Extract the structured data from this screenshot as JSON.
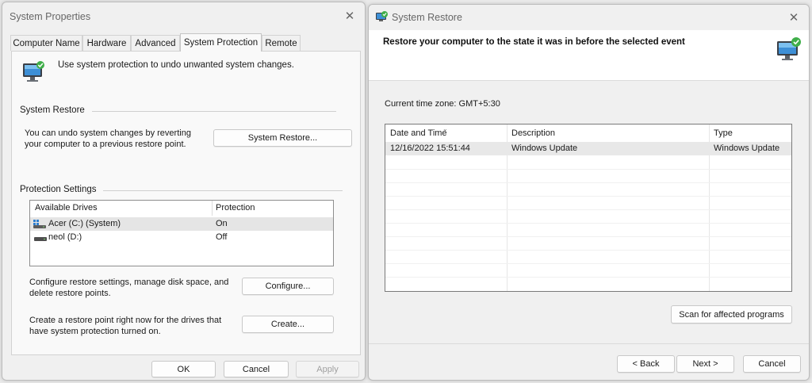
{
  "system_properties": {
    "title": "System Properties",
    "tabs": [
      "Computer Name",
      "Hardware",
      "Advanced",
      "System Protection",
      "Remote"
    ],
    "active_tab": "System Protection",
    "intro_text": "Use system protection to undo unwanted system changes.",
    "system_restore_group": {
      "label": "System Restore",
      "text_line1": "You can undo system changes by reverting",
      "text_line2": "your computer to a previous restore point.",
      "button": "System Restore..."
    },
    "protection_settings_group": {
      "label": "Protection Settings",
      "columns": [
        "Available Drives",
        "Protection"
      ],
      "drives": [
        {
          "name": "Acer (C:) (System)",
          "protection": "On",
          "icon": "system-drive-icon"
        },
        {
          "name": "neol (D:)",
          "protection": "Off",
          "icon": "drive-icon"
        }
      ],
      "configure_text_line1": "Configure restore settings, manage disk space, and",
      "configure_text_line2": "delete restore points.",
      "configure_button": "Configure...",
      "create_text_line1": "Create a restore point right now for the drives that",
      "create_text_line2": "have system protection turned on.",
      "create_button": "Create..."
    },
    "buttons": {
      "ok": "OK",
      "cancel": "Cancel",
      "apply": "Apply"
    }
  },
  "system_restore": {
    "title": "System Restore",
    "heading": "Restore your computer to the state it was in before the selected event",
    "timezone": "Current time zone: GMT+5:30",
    "columns": [
      "Date and Time",
      "Description",
      "Type"
    ],
    "rows": [
      {
        "date": "12/16/2022 15:51:44",
        "description": "Windows Update",
        "type": "Windows Update"
      }
    ],
    "scan_button": "Scan for affected programs",
    "back_button": "< Back",
    "next_button": "Next >",
    "cancel_button": "Cancel"
  }
}
